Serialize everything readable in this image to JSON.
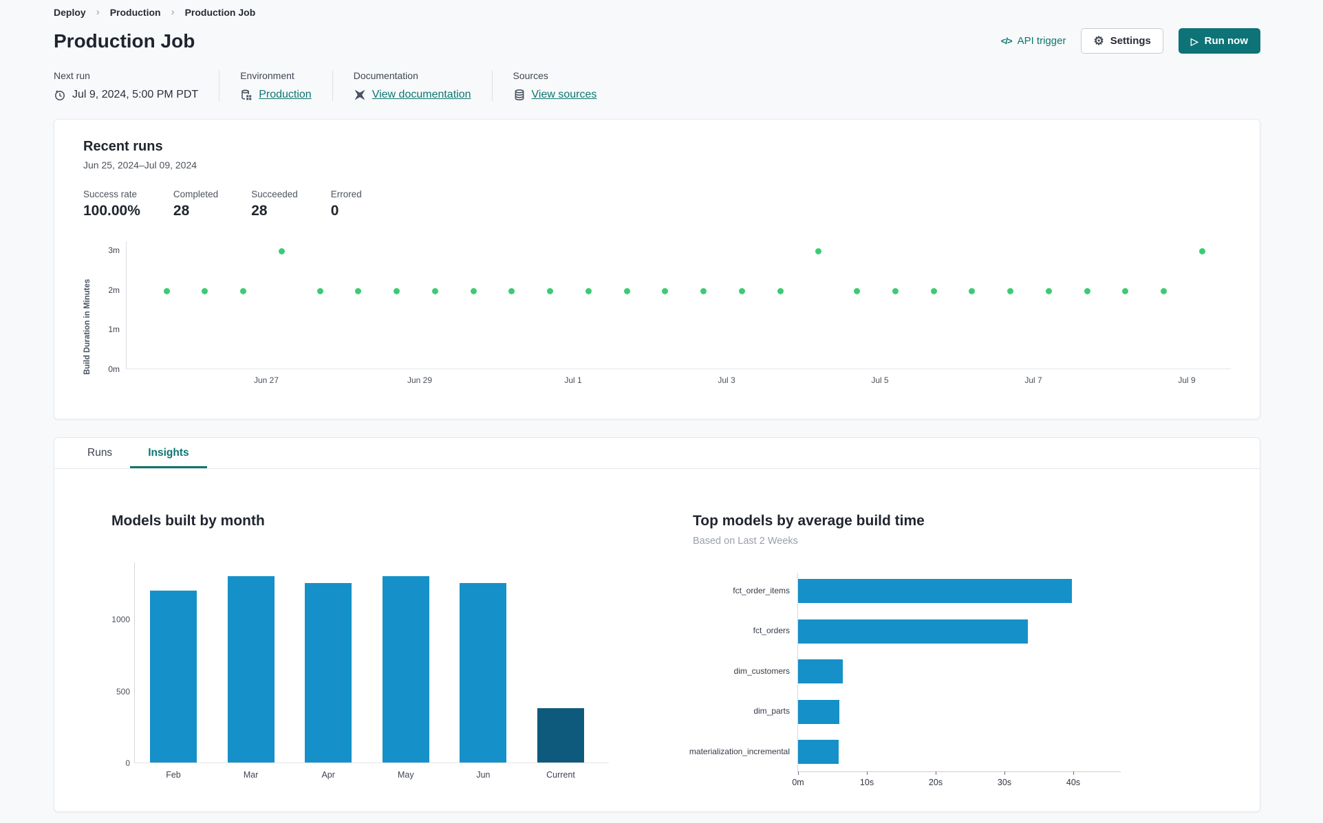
{
  "breadcrumb": {
    "separator": "›",
    "items": [
      {
        "label": "Deploy"
      },
      {
        "label": "Production"
      },
      {
        "label": "Production Job"
      }
    ]
  },
  "header": {
    "title": "Production Job",
    "api_trigger_label": "API trigger",
    "api_trigger_glyph": "</>",
    "settings_label": "Settings",
    "run_now_label": "Run now",
    "run_now_glyph": "▷",
    "settings_glyph": "⚙"
  },
  "meta": {
    "next_run": {
      "label": "Next run",
      "value": "Jul 9, 2024, 5:00 PM PDT"
    },
    "environment": {
      "label": "Environment",
      "value": "Production"
    },
    "documentation": {
      "label": "Documentation",
      "value": "View documentation"
    },
    "sources": {
      "label": "Sources",
      "value": "View sources"
    }
  },
  "recent_runs": {
    "title": "Recent runs",
    "date_range": "Jun 25, 2024–Jul 09, 2024",
    "stats": [
      {
        "label": "Success rate",
        "value": "100.00%"
      },
      {
        "label": "Completed",
        "value": "28"
      },
      {
        "label": "Succeeded",
        "value": "28"
      },
      {
        "label": "Errored",
        "value": "0"
      }
    ]
  },
  "tabs": [
    {
      "label": "Runs",
      "active": false
    },
    {
      "label": "Insights",
      "active": true
    }
  ],
  "colors": {
    "accent_teal": "#0e766e",
    "run_now_bg": "#0d7377",
    "dot_green": "#3bcb74",
    "bar_blue": "#1590c8",
    "bar_navy": "#0d5a7c"
  },
  "chart_data": [
    {
      "id": "build-durations",
      "type": "scatter",
      "title": "Recent runs build durations",
      "ylabel": "Build Duration in Minutes",
      "ylim": [
        0,
        3.2
      ],
      "point_color": "#3bcb74",
      "yticks": [
        {
          "value": 0,
          "label": "0m"
        },
        {
          "value": 1,
          "label": "1m"
        },
        {
          "value": 2,
          "label": "2m"
        },
        {
          "value": 3,
          "label": "3m"
        }
      ],
      "xticks": [
        {
          "day": 2,
          "label": "Jun 27"
        },
        {
          "day": 4,
          "label": "Jun 29"
        },
        {
          "day": 6,
          "label": "Jul 1"
        },
        {
          "day": 8,
          "label": "Jul 3"
        },
        {
          "day": 10,
          "label": "Jul 5"
        },
        {
          "day": 12,
          "label": "Jul 7"
        },
        {
          "day": 14,
          "label": "Jul 9"
        }
      ],
      "points": {
        "x_days": [
          0.7,
          1.2,
          1.7,
          2.2,
          2.7,
          3.2,
          3.7,
          4.2,
          4.7,
          5.2,
          5.7,
          6.2,
          6.7,
          7.2,
          7.7,
          8.2,
          8.7,
          9.2,
          9.7,
          10.2,
          10.7,
          11.2,
          11.7,
          12.2,
          12.7,
          13.2,
          13.7,
          14.2
        ],
        "durations_min": [
          1.95,
          1.95,
          1.95,
          2.95,
          1.95,
          1.95,
          1.95,
          1.95,
          1.95,
          1.95,
          1.95,
          1.95,
          1.95,
          1.95,
          1.95,
          1.95,
          1.95,
          2.95,
          1.95,
          1.95,
          1.95,
          1.95,
          1.95,
          1.95,
          1.95,
          1.95,
          1.95,
          2.95
        ]
      }
    },
    {
      "id": "models-built-by-month",
      "type": "bar",
      "title": "Models built by month",
      "categories": [
        "Feb",
        "Mar",
        "Apr",
        "May",
        "Jun",
        "Current"
      ],
      "values": [
        1200,
        1300,
        1250,
        1300,
        1250,
        380
      ],
      "yticks": [
        0,
        500,
        1000
      ],
      "ylim": [
        0,
        1400
      ],
      "bar_color": "#1590c8",
      "highlight_category": "Current",
      "highlight_color": "#0d5a7c"
    },
    {
      "id": "top-models-by-average-build-time",
      "type": "bar-horizontal",
      "title": "Top models by average build time",
      "subtitle": "Based on Last 2 Weeks",
      "categories": [
        "fct_order_items",
        "fct_orders",
        "dim_customers",
        "dim_parts",
        "materialization_incremental"
      ],
      "values_seconds": [
        39.8,
        33.4,
        6.5,
        6.0,
        5.9
      ],
      "xticks": [
        "0m",
        "10s",
        "20s",
        "30s",
        "40s"
      ],
      "xlim": [
        0,
        47
      ],
      "bar_color": "#1590c8"
    }
  ]
}
